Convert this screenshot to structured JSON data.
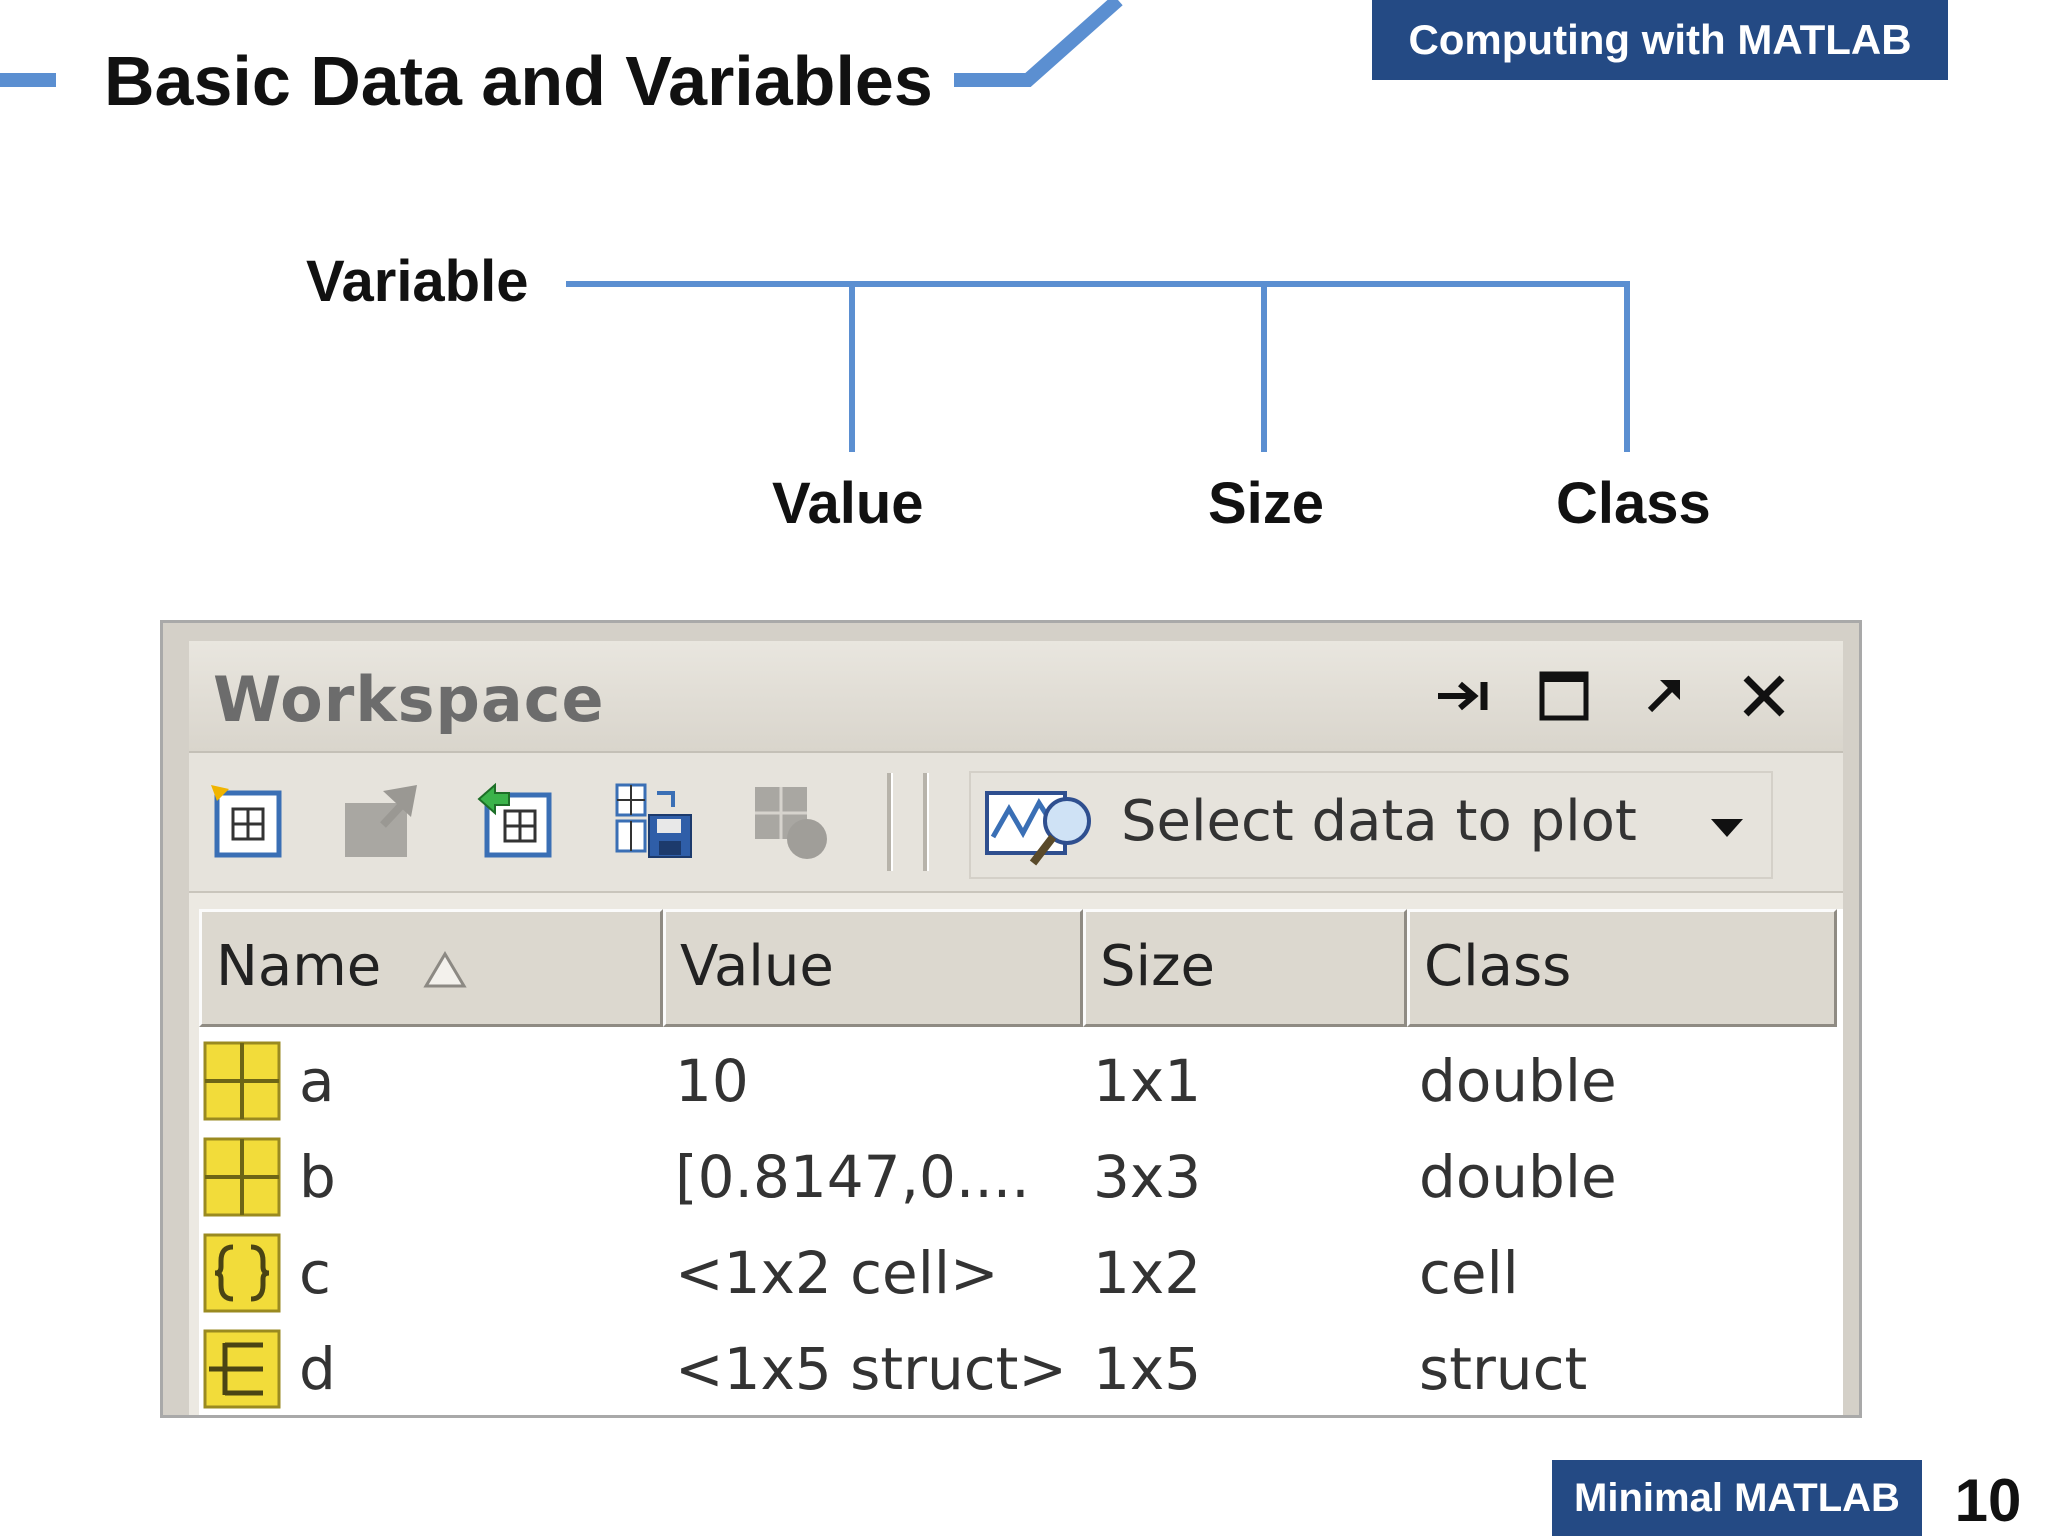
{
  "slide": {
    "title": "Basic Data and Variables",
    "course_badge": "Computing with MATLAB",
    "footer_badge": "Minimal MATLAB",
    "page_number": "10",
    "accent_color": "#244a84",
    "line_color": "#5b8fd1"
  },
  "diagram": {
    "root": "Variable",
    "children": [
      "Value",
      "Size",
      "Class"
    ]
  },
  "workspace": {
    "title": "Workspace",
    "controls": [
      "dock-icon",
      "maximize-icon",
      "undock-icon",
      "close-icon"
    ],
    "toolbar": {
      "tools": [
        "new-variable-icon",
        "open-selection-icon",
        "import-data-icon",
        "save-workspace-icon",
        "delete-icon"
      ],
      "plot_selector": "Select data to plot"
    },
    "columns": [
      "Name",
      "Value",
      "Size",
      "Class"
    ],
    "rows": [
      {
        "name": "a",
        "value": "10",
        "size": "1x1",
        "class": "double",
        "icon": "matrix-icon"
      },
      {
        "name": "b",
        "value": "[0.8147,0....",
        "size": "3x3",
        "class": "double",
        "icon": "matrix-icon"
      },
      {
        "name": "c",
        "value": "<1x2 cell>",
        "size": "1x2",
        "class": "cell",
        "icon": "cell-icon"
      },
      {
        "name": "d",
        "value": "<1x5 struct>",
        "size": "1x5",
        "class": "struct",
        "icon": "struct-icon"
      }
    ]
  }
}
